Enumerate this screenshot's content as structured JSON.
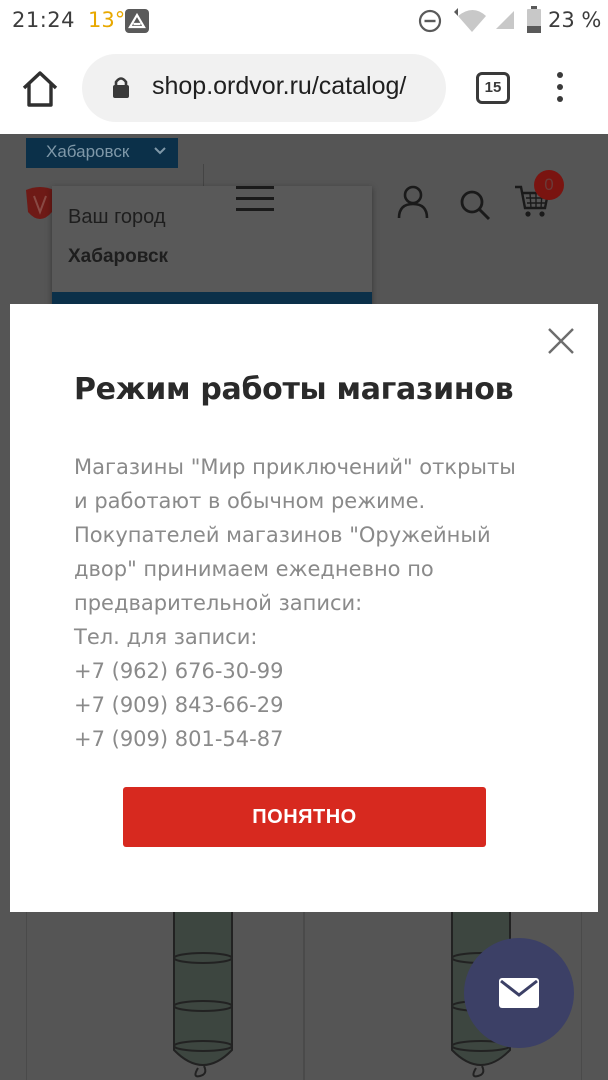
{
  "status_bar": {
    "time": "21:24",
    "temperature": "13°",
    "battery": "23 %",
    "icons": [
      "app-notification-icon",
      "do-not-disturb-icon",
      "wifi-icon",
      "signal-icon",
      "battery-icon"
    ]
  },
  "browser": {
    "url": "shop.ordvor.ru/catalog/",
    "tab_count": "15",
    "icons": [
      "home-icon",
      "lock-icon",
      "tabs-icon",
      "overflow-menu-icon"
    ]
  },
  "page": {
    "city_selector": "Хабаровск",
    "city_popup": {
      "label": "Ваш город",
      "city": "Хабаровск"
    },
    "cart_count": "0",
    "icons": [
      "logo-icon",
      "burger-menu-icon",
      "user-icon",
      "search-icon",
      "cart-icon"
    ]
  },
  "modal": {
    "title": "Режим работы магазинов",
    "lines": [
      "Магазины \"Мир приключений\" открыты",
      "и работают в обычном режиме.",
      "Покупателей магазинов \"Оружейный",
      "двор\" принимаем ежедневно по",
      "предварительной записи:",
      "Тел. для записи:",
      "+7 (962) 676-30-99",
      "+7 (909) 843-66-29",
      "+7 (909) 801-54-87"
    ],
    "button_label": "ПОНЯТНО"
  },
  "fab": {
    "icon": "mail-icon"
  },
  "colors": {
    "accent_red": "#d7291f",
    "city_bar_navy": "#0b3049",
    "fab_bg": "#3c4066",
    "temperature_yellow": "#e8a800"
  }
}
